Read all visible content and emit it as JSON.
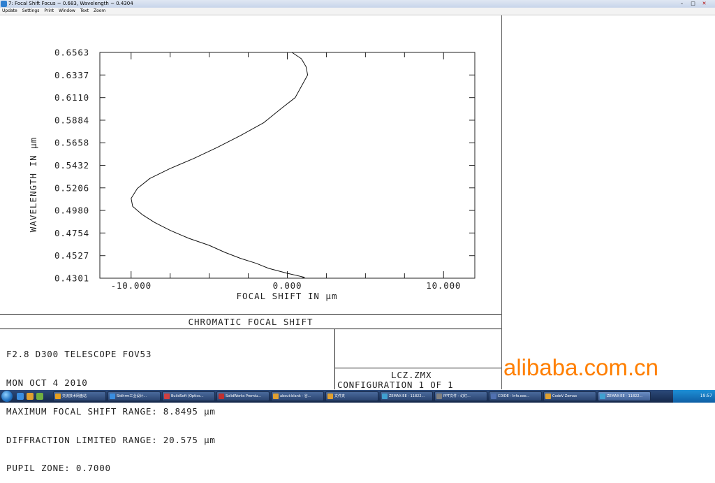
{
  "window": {
    "title": "7: Focal Shift Focus ~ 0.683, Wavelength ~ 0.4304",
    "minimize": "–",
    "maximize": "□",
    "close": "✕"
  },
  "menu": [
    "Update",
    "Settings",
    "Print",
    "Window",
    "Text",
    "Zoom"
  ],
  "chart_data": {
    "type": "line",
    "title": "CHROMATIC FOCAL SHIFT",
    "xlabel": "FOCAL SHIFT IN μm",
    "ylabel": "WAVELENGTH IN μm",
    "xlim": [
      -12.0,
      12.0
    ],
    "ylim": [
      0.4301,
      0.6563
    ],
    "x_tick_values": [
      -10.0,
      0.0,
      10.0
    ],
    "x_tick_labels": [
      "-10.000",
      "0.000",
      "10.000"
    ],
    "y_tick_values": [
      0.4301,
      0.4527,
      0.4754,
      0.498,
      0.5206,
      0.5432,
      0.5658,
      0.5884,
      0.611,
      0.6337,
      0.6563
    ],
    "y_tick_labels": [
      "0.4301",
      "0.4527",
      "0.4754",
      "0.4980",
      "0.5206",
      "0.5432",
      "0.5658",
      "0.5884",
      "0.6110",
      "0.6337",
      "0.6563"
    ],
    "series": [
      {
        "x": [
          0.9,
          1.1,
          0.0,
          -1.2,
          -2.0,
          -3.0,
          -4.0,
          -5.0,
          -6.3,
          -7.5,
          -8.5,
          -9.3,
          -9.9,
          -10.0,
          -9.6,
          -8.8,
          -7.5,
          -6.0,
          -4.5,
          -3.0,
          -1.5,
          -0.4,
          0.5,
          1.3
        ],
        "y": [
          0.4301,
          0.431,
          0.435,
          0.44,
          0.445,
          0.45,
          0.456,
          0.463,
          0.47,
          0.478,
          0.486,
          0.494,
          0.502,
          0.51,
          0.52,
          0.53,
          0.54,
          0.55,
          0.561,
          0.573,
          0.586,
          0.6,
          0.611,
          0.6337
        ]
      },
      {
        "x": [
          1.3,
          1.2,
          0.9,
          0.3
        ],
        "y": [
          0.6337,
          0.642,
          0.65,
          0.6563
        ]
      }
    ],
    "grid": false
  },
  "info": {
    "line1": "F2.8 D300 TELESCOPE FOV53",
    "line2": "MON OCT 4 2010",
    "line3": "MAXIMUM FOCAL SHIFT RANGE: 8.8495 μm",
    "line4": "DIFFRACTION LIMITED RANGE: 20.575 μm",
    "line5": "PUPIL ZONE: 0.7000"
  },
  "config": {
    "file": "LCZ.ZMX",
    "configuration": "CONFIGURATION 1 OF 1"
  },
  "watermark": "alibaba.com.cn",
  "taskbar": {
    "items": [
      "交流技术网盘站",
      "Stdhrm工业设计...",
      "BuildSoft (Optics...",
      "SolidWorks Premiu...",
      "about:blank - 谷...",
      "文件夹",
      "ZEMAX-EE - 11822...",
      "PPT文件 - 幻灯...",
      "CDIDE - Info.exe...",
      "CodeV Zemax",
      "ZEMAX-EE - 11822..."
    ],
    "clock": "19:57"
  }
}
